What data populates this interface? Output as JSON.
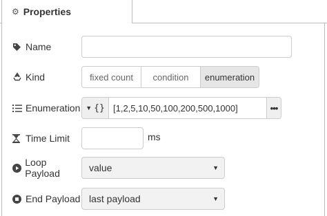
{
  "tab": {
    "title": "Properties",
    "icon": "gear-icon"
  },
  "fields": {
    "name": {
      "label": "Name",
      "icon": "tag-icon",
      "value": ""
    },
    "kind": {
      "label": "Kind",
      "icon": "recycle-icon",
      "options": [
        "fixed count",
        "condition",
        "enumeration"
      ],
      "selected": "enumeration"
    },
    "enumeration": {
      "label": "Enumeration",
      "icon": "list-ol-icon",
      "type_symbol": "{}",
      "value": "[1,2,5,10,50,100,200,500,1000]",
      "more": "•••"
    },
    "time_limit": {
      "label": "Time Limit",
      "icon": "hourglass-icon",
      "value": "",
      "unit": "ms"
    },
    "loop_payload": {
      "label": "Loop Payload",
      "icon": "play-circle-icon",
      "value": "value"
    },
    "end_payload": {
      "label": "End Payload",
      "icon": "stop-circle-icon",
      "value": "last payload"
    }
  },
  "colors": {
    "border": "#cccccc",
    "selected_segment": "#e6e6e6",
    "select_bg": "#f2f2f2",
    "text": "#333333"
  }
}
